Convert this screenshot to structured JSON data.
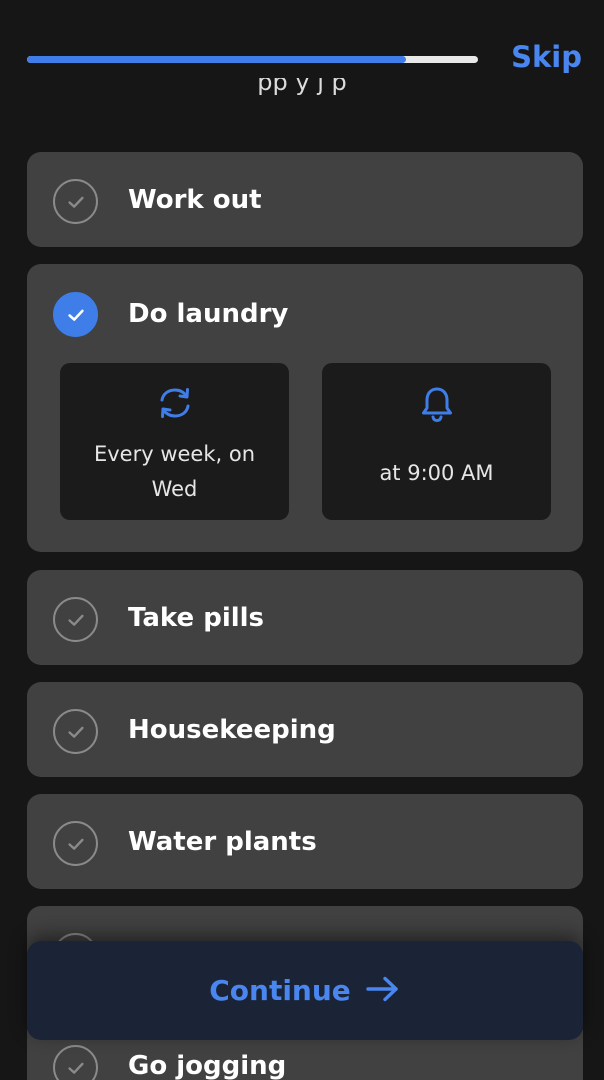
{
  "header": {
    "progress_percent": 84,
    "skip_label": "Skip",
    "subtitle_partial": "pp y  j  p"
  },
  "tasks": [
    {
      "label": "Work out",
      "checked": false
    },
    {
      "label": "Do laundry",
      "checked": true,
      "repeat_text_line1": "Every week, on",
      "repeat_text_line2": "Wed",
      "reminder_text": "at 9:00 AM"
    },
    {
      "label": "Take pills",
      "checked": false
    },
    {
      "label": "Housekeeping",
      "checked": false
    },
    {
      "label": "Water plants",
      "checked": false
    },
    {
      "label": "",
      "checked": false
    },
    {
      "label": "Go jogging",
      "checked": false
    }
  ],
  "footer": {
    "continue_label": "Continue",
    "continue_icon": "arrow-right-icon"
  },
  "icons": {
    "check": "check-icon",
    "repeat": "repeat-icon",
    "reminder": "bell-icon"
  },
  "colors": {
    "accent": "#3f7ee8",
    "background": "#161616",
    "card": "#414141",
    "detail_box": "#1b1b1b"
  }
}
